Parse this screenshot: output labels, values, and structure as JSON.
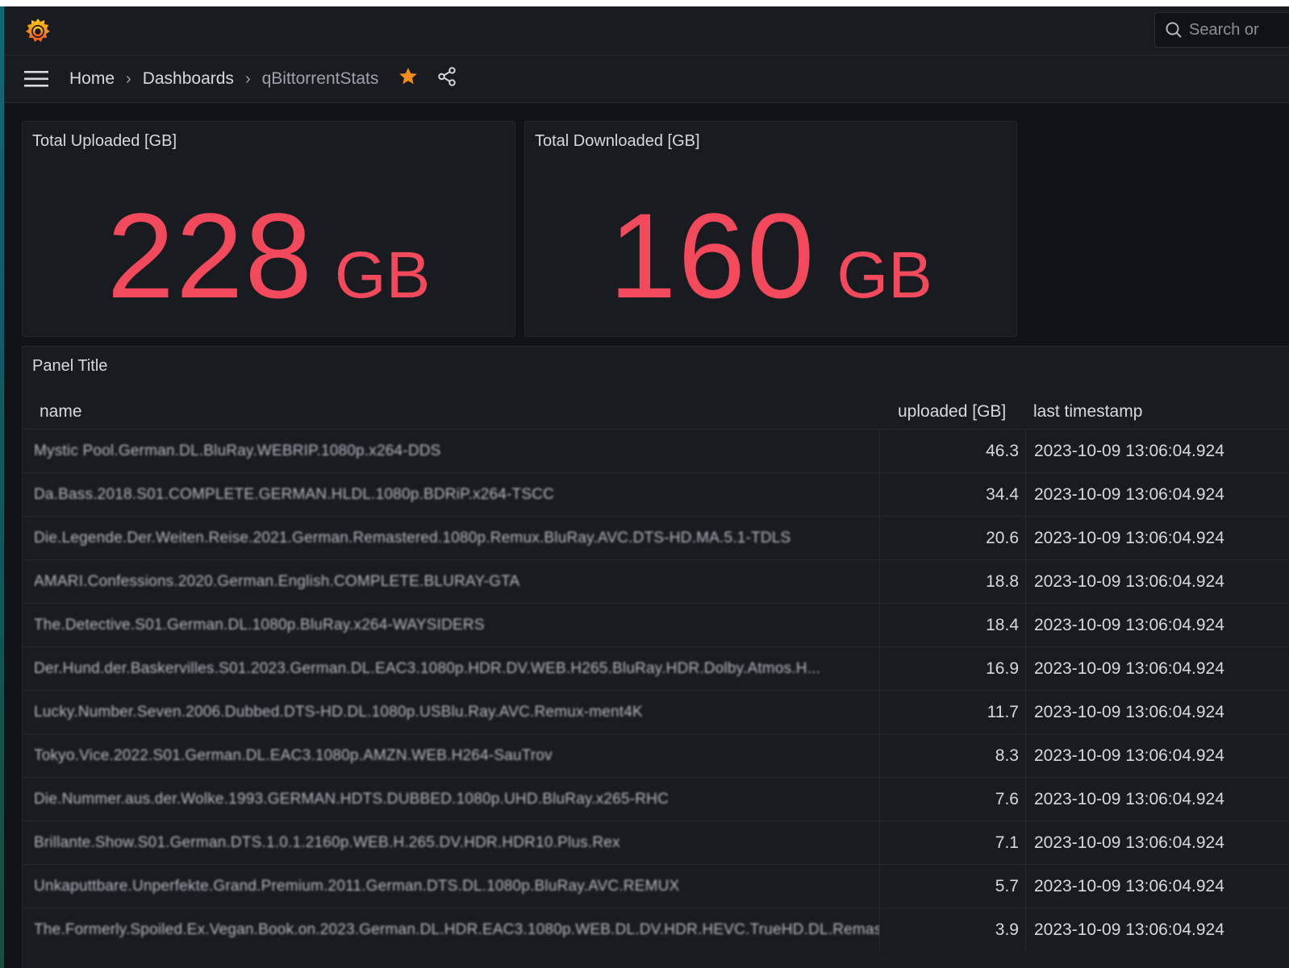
{
  "topbar": {
    "logo_icon": "grafana-logo-icon",
    "search_placeholder": "Search or"
  },
  "navbar": {
    "menu_icon": "hamburger-menu-icon",
    "breadcrumb": [
      "Home",
      "Dashboards",
      "qBittorrentStats"
    ],
    "separator": "›",
    "star_color": "#f28b1d"
  },
  "stats": [
    {
      "title": "Total Uploaded [GB]",
      "value": "228",
      "unit": "GB"
    },
    {
      "title": "Total Downloaded [GB]",
      "value": "160",
      "unit": "GB"
    }
  ],
  "colors": {
    "stat": "#f2495c"
  },
  "table": {
    "title": "Panel Title",
    "columns": [
      "name",
      "uploaded [GB]",
      "last timestamp"
    ],
    "rows": [
      {
        "name": "Mystic Pool.German.DL.BluRay.WEBRIP.1080p.x264-DDS",
        "uploaded": "46.3",
        "ts": "2023-10-09 13:06:04.924"
      },
      {
        "name": "Da.Bass.2018.S01.COMPLETE.GERMAN.HLDL.1080p.BDRiP.x264-TSCC",
        "uploaded": "34.4",
        "ts": "2023-10-09 13:06:04.924"
      },
      {
        "name": "Die.Legende.Der.Weiten.Reise.2021.German.Remastered.1080p.Remux.BluRay.AVC.DTS-HD.MA.5.1-TDLS",
        "uploaded": "20.6",
        "ts": "2023-10-09 13:06:04.924"
      },
      {
        "name": "AMARI.Confessions.2020.German.English.COMPLETE.BLURAY-GTA",
        "uploaded": "18.8",
        "ts": "2023-10-09 13:06:04.924"
      },
      {
        "name": "The.Detective.S01.German.DL.1080p.BluRay.x264-WAYSIDERS",
        "uploaded": "18.4",
        "ts": "2023-10-09 13:06:04.924"
      },
      {
        "name": "Der.Hund.der.Baskervilles.S01.2023.German.DL.EAC3.1080p.HDR.DV.WEB.H265.BluRay.HDR.Dolby.Atmos.H...",
        "uploaded": "16.9",
        "ts": "2023-10-09 13:06:04.924"
      },
      {
        "name": "Lucky.Number.Seven.2006.Dubbed.DTS-HD.DL.1080p.USBlu.Ray.AVC.Remux-ment4K",
        "uploaded": "11.7",
        "ts": "2023-10-09 13:06:04.924"
      },
      {
        "name": "Tokyo.Vice.2022.S01.German.DL.EAC3.1080p.AMZN.WEB.H264-SauTrov",
        "uploaded": "8.3",
        "ts": "2023-10-09 13:06:04.924"
      },
      {
        "name": "Die.Nummer.aus.der.Wolke.1993.GERMAN.HDTS.DUBBED.1080p.UHD.BluRay.x265-RHC",
        "uploaded": "7.6",
        "ts": "2023-10-09 13:06:04.924"
      },
      {
        "name": "Brillante.Show.S01.German.DTS.1.0.1.2160p.WEB.H.265.DV.HDR.HDR10.Plus.Rex",
        "uploaded": "7.1",
        "ts": "2023-10-09 13:06:04.924"
      },
      {
        "name": "Unkaputtbare.Unperfekte.Grand.Premium.2011.German.DTS.DL.1080p.BluRay.AVC.REMUX",
        "uploaded": "5.7",
        "ts": "2023-10-09 13:06:04.924"
      },
      {
        "name": "The.Formerly.Spoiled.Ex.Vegan.Book.on.2023.German.DL.HDR.EAC3.1080p.WEB.DL.DV.HDR.HEVC.TrueHD.DL.Remaster",
        "uploaded": "3.9",
        "ts": "2023-10-09 13:06:04.924"
      }
    ]
  }
}
